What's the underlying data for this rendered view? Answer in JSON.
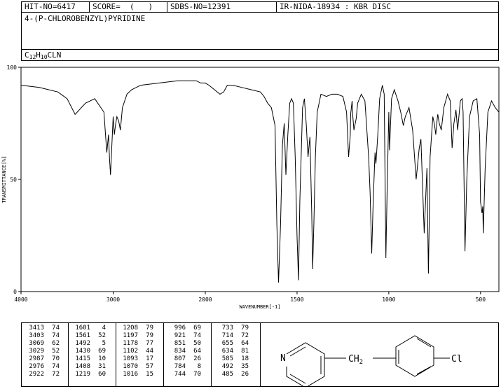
{
  "header": {
    "hit_no": "HIT-NO=6417",
    "score": "SCORE=  (   )",
    "sdbs_no": "SDBS-NO=12391",
    "ir_info": "IR-NIDA-18934 : KBR DISC"
  },
  "compound": {
    "name": "4-(P-CHLOROBENZYL)PYRIDINE",
    "formula_c": "C",
    "formula_c_sub": "12",
    "formula_h": "H",
    "formula_h_sub": "10",
    "formula_rest": "CLN"
  },
  "structure": {
    "n_label": "N",
    "ch2_label": "CH",
    "ch2_sub": "2",
    "cl_label": "Cl"
  },
  "chart_data": {
    "type": "line",
    "xlabel": "WAVENUMBER[-1]",
    "ylabel": "TRANSMITTANCE[%]",
    "xlim": [
      4000,
      400
    ],
    "ylim": [
      0,
      100
    ],
    "x_ticks": [
      "4000",
      "3000",
      "2000",
      "1500",
      "1000",
      "500"
    ],
    "y_ticks": [
      "100",
      "50",
      "0"
    ],
    "curve": {
      "x": [
        4000,
        3800,
        3600,
        3500,
        3413,
        3300,
        3200,
        3100,
        3069,
        3050,
        3040,
        3029,
        3000,
        2987,
        2976,
        2960,
        2940,
        2922,
        2900,
        2850,
        2800,
        2700,
        2500,
        2300,
        2200,
        2100,
        2050,
        2000,
        1980,
        1950,
        1920,
        1900,
        1880,
        1850,
        1800,
        1750,
        1700,
        1680,
        1660,
        1640,
        1620,
        1610,
        1601,
        1590,
        1580,
        1570,
        1561,
        1550,
        1540,
        1530,
        1520,
        1510,
        1500,
        1492,
        1485,
        1470,
        1460,
        1450,
        1440,
        1430,
        1420,
        1415,
        1408,
        1400,
        1390,
        1370,
        1340,
        1310,
        1280,
        1250,
        1230,
        1219,
        1210,
        1208,
        1200,
        1197,
        1190,
        1178,
        1170,
        1150,
        1130,
        1110,
        1102,
        1093,
        1085,
        1075,
        1070,
        1060,
        1050,
        1035,
        1025,
        1016,
        1008,
        1000,
        996,
        985,
        970,
        950,
        935,
        921,
        910,
        890,
        870,
        851,
        845,
        834,
        825,
        815,
        807,
        800,
        792,
        784,
        780,
        775,
        760,
        750,
        744,
        735,
        733,
        725,
        714,
        700,
        680,
        665,
        655,
        645,
        634,
        625,
        610,
        600,
        595,
        585,
        575,
        560,
        540,
        520,
        505,
        500,
        492,
        488,
        485,
        475,
        460,
        440,
        420,
        400
      ],
      "y": [
        92,
        91,
        89,
        86,
        79,
        84,
        86,
        80,
        62,
        70,
        60,
        52,
        78,
        70,
        74,
        78,
        76,
        72,
        82,
        88,
        90,
        92,
        93,
        94,
        94,
        94,
        93,
        93,
        92,
        90,
        88,
        89,
        92,
        92,
        91,
        90,
        89,
        87,
        84,
        82,
        74,
        30,
        4,
        30,
        65,
        75,
        52,
        70,
        84,
        86,
        84,
        60,
        25,
        5,
        40,
        82,
        86,
        75,
        60,
        69,
        35,
        10,
        31,
        60,
        80,
        88,
        87,
        88,
        88,
        87,
        80,
        60,
        70,
        79,
        85,
        79,
        72,
        77,
        84,
        88,
        85,
        60,
        44,
        17,
        40,
        62,
        57,
        70,
        86,
        92,
        88,
        15,
        50,
        80,
        63,
        86,
        90,
        85,
        80,
        74,
        78,
        82,
        72,
        50,
        55,
        64,
        68,
        45,
        26,
        40,
        55,
        8,
        30,
        60,
        78,
        74,
        70,
        78,
        79,
        75,
        72,
        82,
        88,
        85,
        64,
        75,
        81,
        72,
        85,
        86,
        80,
        18,
        50,
        78,
        85,
        86,
        70,
        40,
        35,
        38,
        26,
        55,
        80,
        85,
        82,
        80
      ]
    },
    "peak_table": [
      [
        3413,
        74
      ],
      [
        3403,
        74
      ],
      [
        3069,
        62
      ],
      [
        3029,
        52
      ],
      [
        2987,
        70
      ],
      [
        2976,
        74
      ],
      [
        2922,
        72
      ],
      [
        1601,
        4
      ],
      [
        1561,
        52
      ],
      [
        1492,
        5
      ],
      [
        1430,
        69
      ],
      [
        1415,
        10
      ],
      [
        1408,
        31
      ],
      [
        1219,
        60
      ],
      [
        1208,
        79
      ],
      [
        1197,
        79
      ],
      [
        1178,
        77
      ],
      [
        1102,
        44
      ],
      [
        1093,
        17
      ],
      [
        1070,
        57
      ],
      [
        1016,
        15
      ],
      [
        996,
        69
      ],
      [
        921,
        74
      ],
      [
        851,
        50
      ],
      [
        834,
        64
      ],
      [
        807,
        26
      ],
      [
        784,
        8
      ],
      [
        744,
        70
      ],
      [
        733,
        79
      ],
      [
        714,
        72
      ],
      [
        655,
        64
      ],
      [
        634,
        81
      ],
      [
        585,
        18
      ],
      [
        492,
        35
      ],
      [
        485,
        26
      ]
    ]
  }
}
